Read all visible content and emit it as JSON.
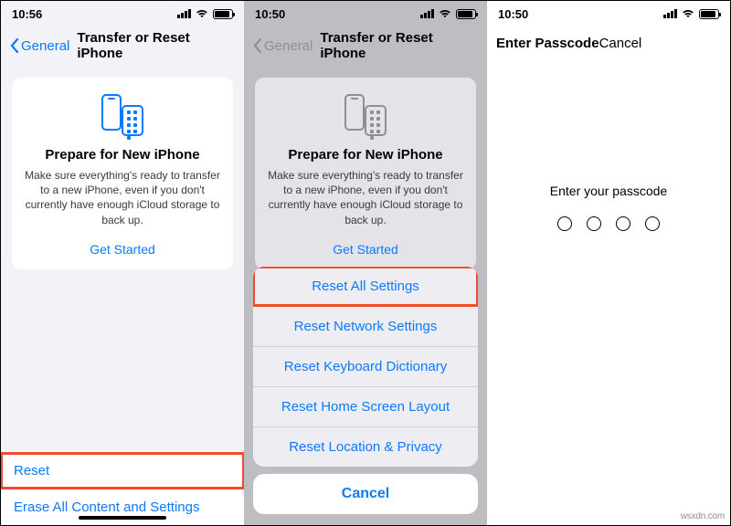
{
  "status": {
    "time1": "10:56",
    "time2": "10:50",
    "time3": "10:50"
  },
  "panel1": {
    "back": "General",
    "title": "Transfer or Reset iPhone",
    "card": {
      "heading": "Prepare for New iPhone",
      "body": "Make sure everything's ready to transfer to a new iPhone, even if you don't currently have enough iCloud storage to back up.",
      "cta": "Get Started"
    },
    "rows": {
      "reset": "Reset",
      "erase": "Erase All Content and Settings"
    }
  },
  "panel2": {
    "back": "General",
    "title": "Transfer or Reset iPhone",
    "card": {
      "heading": "Prepare for New iPhone",
      "body": "Make sure everything's ready to transfer to a new iPhone, even if you don't currently have enough iCloud storage to back up.",
      "cta": "Get Started"
    },
    "sheet": {
      "opts": {
        "all": "Reset All Settings",
        "net": "Reset Network Settings",
        "kbd": "Reset Keyboard Dictionary",
        "home": "Reset Home Screen Layout",
        "loc": "Reset Location & Privacy"
      },
      "cancel": "Cancel"
    }
  },
  "panel3": {
    "title": "Enter Passcode",
    "cancel": "Cancel",
    "prompt": "Enter your passcode"
  },
  "watermark": "wsxdn.com"
}
